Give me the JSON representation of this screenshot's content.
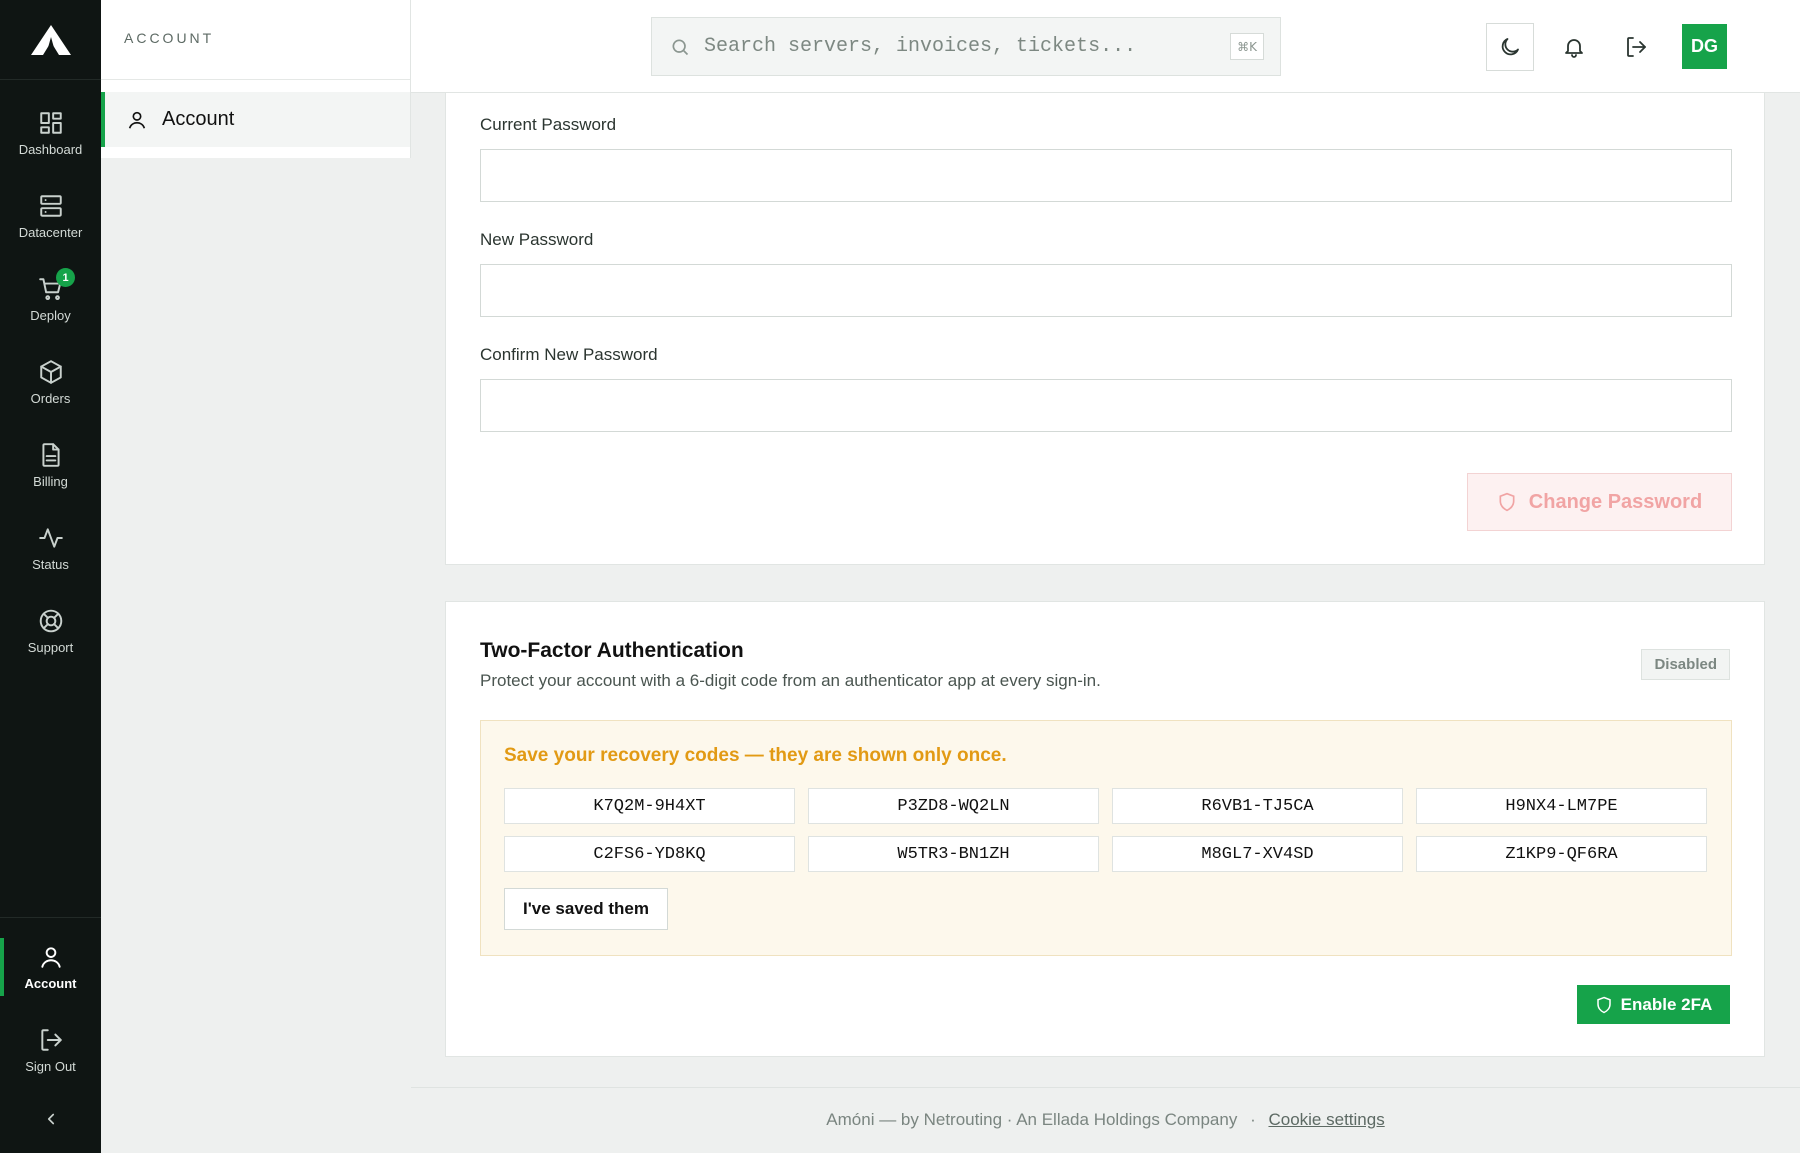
{
  "rail": {
    "items": [
      {
        "label": "Dashboard",
        "icon": "dashboard-icon"
      },
      {
        "label": "Datacenter",
        "icon": "server-icon"
      },
      {
        "label": "Deploy",
        "icon": "cart-icon",
        "badge": "1"
      },
      {
        "label": "Orders",
        "icon": "box-icon"
      },
      {
        "label": "Billing",
        "icon": "document-icon"
      },
      {
        "label": "Status",
        "icon": "activity-icon"
      },
      {
        "label": "Support",
        "icon": "lifebuoy-icon"
      }
    ],
    "bottom": [
      {
        "label": "Account",
        "icon": "user-icon",
        "active": true
      },
      {
        "label": "Sign Out",
        "icon": "sign-out-icon"
      }
    ]
  },
  "subpanel": {
    "heading": "ACCOUNT",
    "item": "Account"
  },
  "search": {
    "placeholder": "Search servers, invoices, tickets...",
    "shortcut": "⌘K"
  },
  "user": {
    "initials": "DG"
  },
  "password_form": {
    "current_label": "Current Password",
    "new_label": "New Password",
    "confirm_label": "Confirm New Password",
    "submit_label": "Change Password"
  },
  "two_factor": {
    "title": "Two-Factor Authentication",
    "description": "Protect your account with a 6-digit code from an authenticator app at every sign-in.",
    "status": "Disabled",
    "recovery_title": "Save your recovery codes — they are shown only once.",
    "codes": [
      "K7Q2M-9H4XT",
      "P3ZD8-WQ2LN",
      "R6VB1-TJ5CA",
      "H9NX4-LM7PE",
      "C2FS6-YD8KQ",
      "W5TR3-BN1ZH",
      "M8GL7-XV4SD",
      "Z1KP9-QF6RA"
    ],
    "saved_label": "I've saved them",
    "enable_label": "Enable 2FA"
  },
  "footer": {
    "text": "Amóni — by Netrouting · An Ellada Holdings Company",
    "separator": "·",
    "cookie_link": "Cookie settings"
  },
  "colors": {
    "accent": "#16a34a",
    "rail_bg": "#0f1513",
    "warning_text": "#e29a14"
  }
}
